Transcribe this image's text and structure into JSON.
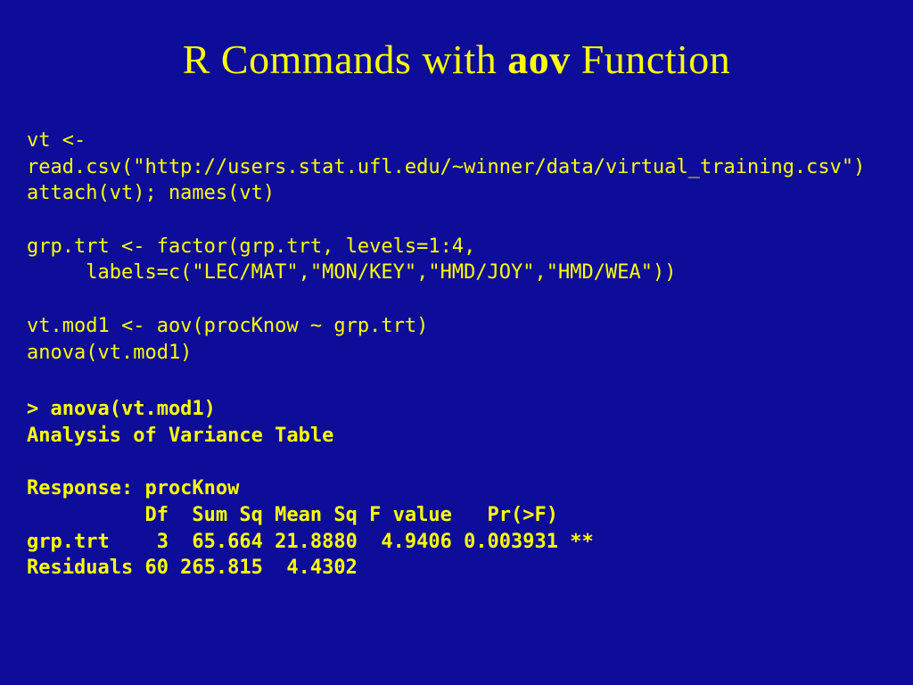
{
  "title": {
    "pre": "R Commands with ",
    "bold": "aov",
    "post": " Function"
  },
  "code": "vt <-\nread.csv(\"http://users.stat.ufl.edu/~winner/data/virtual_training.csv\")\nattach(vt); names(vt)\n\ngrp.trt <- factor(grp.trt, levels=1:4,\n     labels=c(\"LEC/MAT\",\"MON/KEY\",\"HMD/JOY\",\"HMD/WEA\"))\n\nvt.mod1 <- aov(procKnow ~ grp.trt)\nanova(vt.mod1)",
  "output": "> anova(vt.mod1)\nAnalysis of Variance Table\n\nResponse: procKnow\n          Df  Sum Sq Mean Sq F value   Pr(>F)   \ngrp.trt    3  65.664 21.8880  4.9406 0.003931 **\nResiduals 60 265.815  4.4302"
}
